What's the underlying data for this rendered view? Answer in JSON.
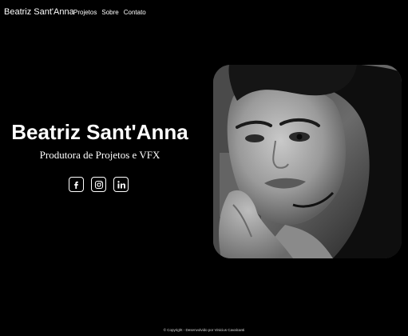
{
  "navbar": {
    "brand": "Beatriz Sant'Anna",
    "links": [
      "Projetos",
      "Sobre",
      "Contato"
    ]
  },
  "hero": {
    "name": "Beatriz Sant'Anna",
    "role": "Produtora de Projetos e VFX",
    "socials": [
      "facebook-icon",
      "instagram-icon",
      "linkedin-icon"
    ]
  },
  "footer": {
    "text": "© Copyright - Desenvolvido por Vinicius Cavalcanti"
  },
  "colors": {
    "background": "#000000",
    "text": "#ffffff"
  }
}
